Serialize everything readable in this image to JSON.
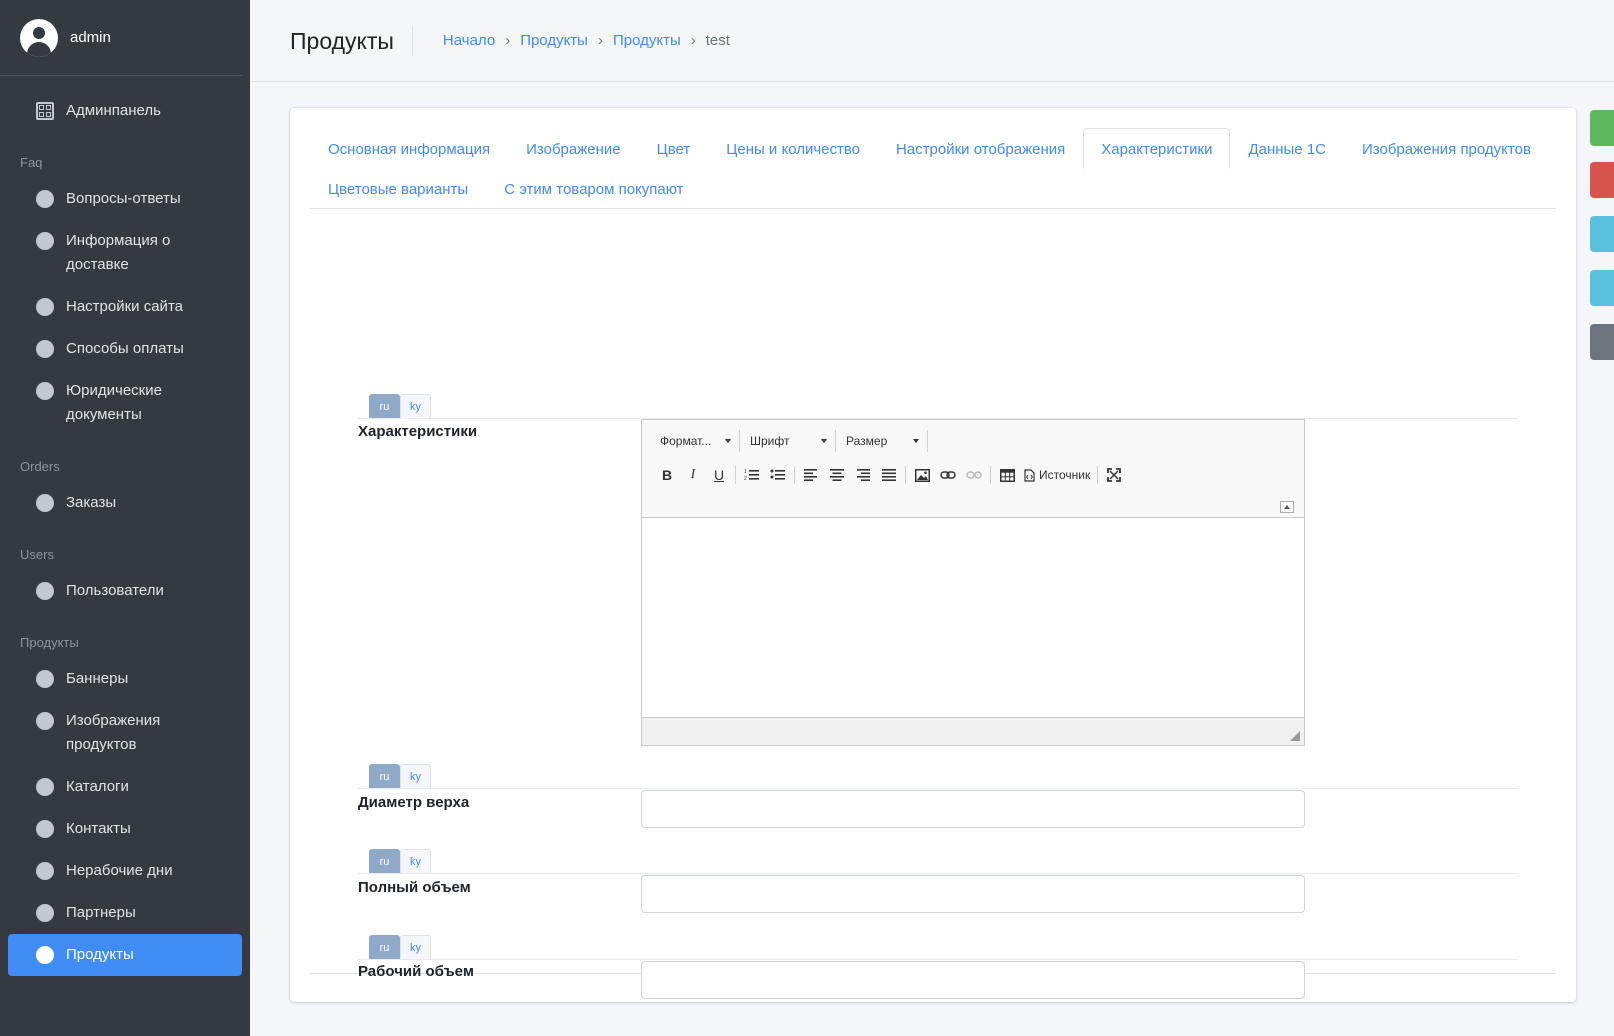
{
  "user": {
    "name": "admin"
  },
  "sidebar": {
    "dashboard": "Админпанель",
    "sections": [
      {
        "header": "Faq",
        "items": [
          "Вопросы-ответы",
          "Информация о доставке",
          "Настройки сайта",
          "Способы оплаты",
          "Юридические документы"
        ]
      },
      {
        "header": "Orders",
        "items": [
          "Заказы"
        ]
      },
      {
        "header": "Users",
        "items": [
          "Пользователи"
        ]
      },
      {
        "header": "Продукты",
        "items": [
          "Баннеры",
          "Изображения продуктов",
          "Каталоги",
          "Контакты",
          "Нерабочие дни",
          "Партнеры",
          "Продукты"
        ]
      }
    ],
    "active_item": "Продукты"
  },
  "header": {
    "title": "Продукты",
    "breadcrumb": [
      "Начало",
      "Продукты",
      "Продукты"
    ],
    "breadcrumb_current": "test"
  },
  "tabs": [
    "Основная информация",
    "Изображение",
    "Цвет",
    "Цены и количество",
    "Настройки отображения",
    "Характеристики",
    "Данные 1С",
    "Изображения продуктов",
    "Цветовые варианты",
    "С этим товаром покупают"
  ],
  "active_tab": "Характеристики",
  "lang_tabs": [
    "ru",
    "ky"
  ],
  "fields": {
    "characteristics": "Характеристики",
    "top_diameter": "Диаметр верха",
    "full_volume": "Полный объем",
    "working_volume": "Рабочий объем"
  },
  "editor": {
    "format": "Формат...",
    "font": "Шрифт",
    "size": "Размер",
    "source": "Источник",
    "buttons": [
      "bold-icon",
      "italic-icon",
      "underline-icon",
      "numbered-list-icon",
      "bulleted-list-icon",
      "align-left-icon",
      "align-center-icon",
      "align-right-icon",
      "justify-icon",
      "image-icon",
      "link-icon",
      "unlink-icon",
      "table-icon",
      "source-icon",
      "maximize-icon"
    ]
  },
  "side_buttons": [
    "#5cb85c",
    "#d9534f",
    "#5bc0de",
    "#5bc0de",
    "#6c757d"
  ]
}
